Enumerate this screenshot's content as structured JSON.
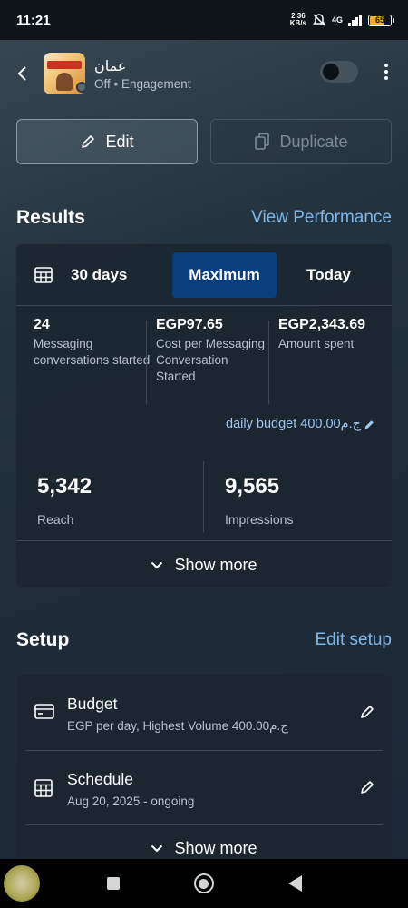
{
  "status_bar": {
    "time": "11:21",
    "speed_value": "2.36",
    "speed_unit": "KB/s",
    "network": "4G",
    "battery": "65",
    "battery_level": 0.65
  },
  "header": {
    "ad_name": "عمان",
    "status_text": "Off • Engagement",
    "toggle_on": false
  },
  "actions": {
    "edit_label": "Edit",
    "duplicate_label": "Duplicate"
  },
  "results": {
    "title": "Results",
    "link": "View Performance",
    "tabs": [
      "30 days",
      "Maximum",
      "Today"
    ],
    "selected_tab": "Maximum",
    "metrics": [
      {
        "value": "24",
        "label": "Messaging conversations started"
      },
      {
        "value": "EGP97.65",
        "label": "Cost per Messaging Conversation Started"
      },
      {
        "value": "EGP2,343.69",
        "label": "Amount spent"
      }
    ],
    "budget_text": "daily budget 400.00ج.م",
    "reach_value": "5,342",
    "reach_label": "Reach",
    "impressions_value": "9,565",
    "impressions_label": "Impressions",
    "show_more": "Show more"
  },
  "setup": {
    "title": "Setup",
    "link": "Edit setup",
    "rows": [
      {
        "title": "Budget",
        "subtitle": "EGP per day, Highest Volume 400.00ج.م",
        "icon": "card-icon"
      },
      {
        "title": "Schedule",
        "subtitle": "Aug 20, 2025 - ongoing",
        "icon": "calendar-grid-icon"
      }
    ],
    "show_more": "Show more"
  },
  "colors": {
    "accent_link": "#7fb6e6",
    "selected_tab_bg": "#0a3f7f",
    "battery": "#f2b21c"
  }
}
